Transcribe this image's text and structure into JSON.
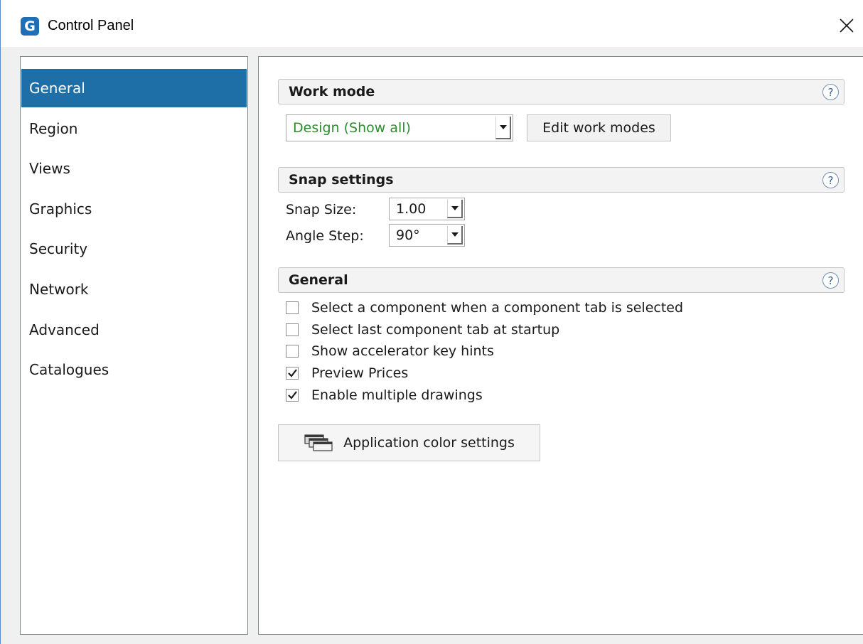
{
  "window": {
    "title": "Control Panel",
    "app_icon_letter": "G"
  },
  "sidebar": {
    "items": [
      {
        "label": "General",
        "active": true
      },
      {
        "label": "Region",
        "active": false
      },
      {
        "label": "Views",
        "active": false
      },
      {
        "label": "Graphics",
        "active": false
      },
      {
        "label": "Security",
        "active": false
      },
      {
        "label": "Network",
        "active": false
      },
      {
        "label": "Advanced",
        "active": false
      },
      {
        "label": "Catalogues",
        "active": false
      }
    ]
  },
  "work_mode": {
    "title": "Work mode",
    "help": "?",
    "selected": "Design (Show all)",
    "edit_button": "Edit work modes"
  },
  "snap": {
    "title": "Snap settings",
    "help": "?",
    "size_label": "Snap Size:",
    "size_value": "1.00",
    "angle_label": "Angle Step:",
    "angle_value": "90°"
  },
  "general": {
    "title": "General",
    "help": "?",
    "options": [
      {
        "label": "Select a component when a component tab is selected",
        "checked": false
      },
      {
        "label": "Select last component tab at startup",
        "checked": false
      },
      {
        "label": "Show accelerator key hints",
        "checked": false
      },
      {
        "label": "Preview Prices",
        "checked": true
      },
      {
        "label": "Enable multiple drawings",
        "checked": true
      }
    ],
    "color_button": "Application color settings"
  },
  "colors": {
    "selection": "#1e6fa8",
    "work_mode_text": "#2e8b2e",
    "app_icon": "#1f6fb8"
  }
}
